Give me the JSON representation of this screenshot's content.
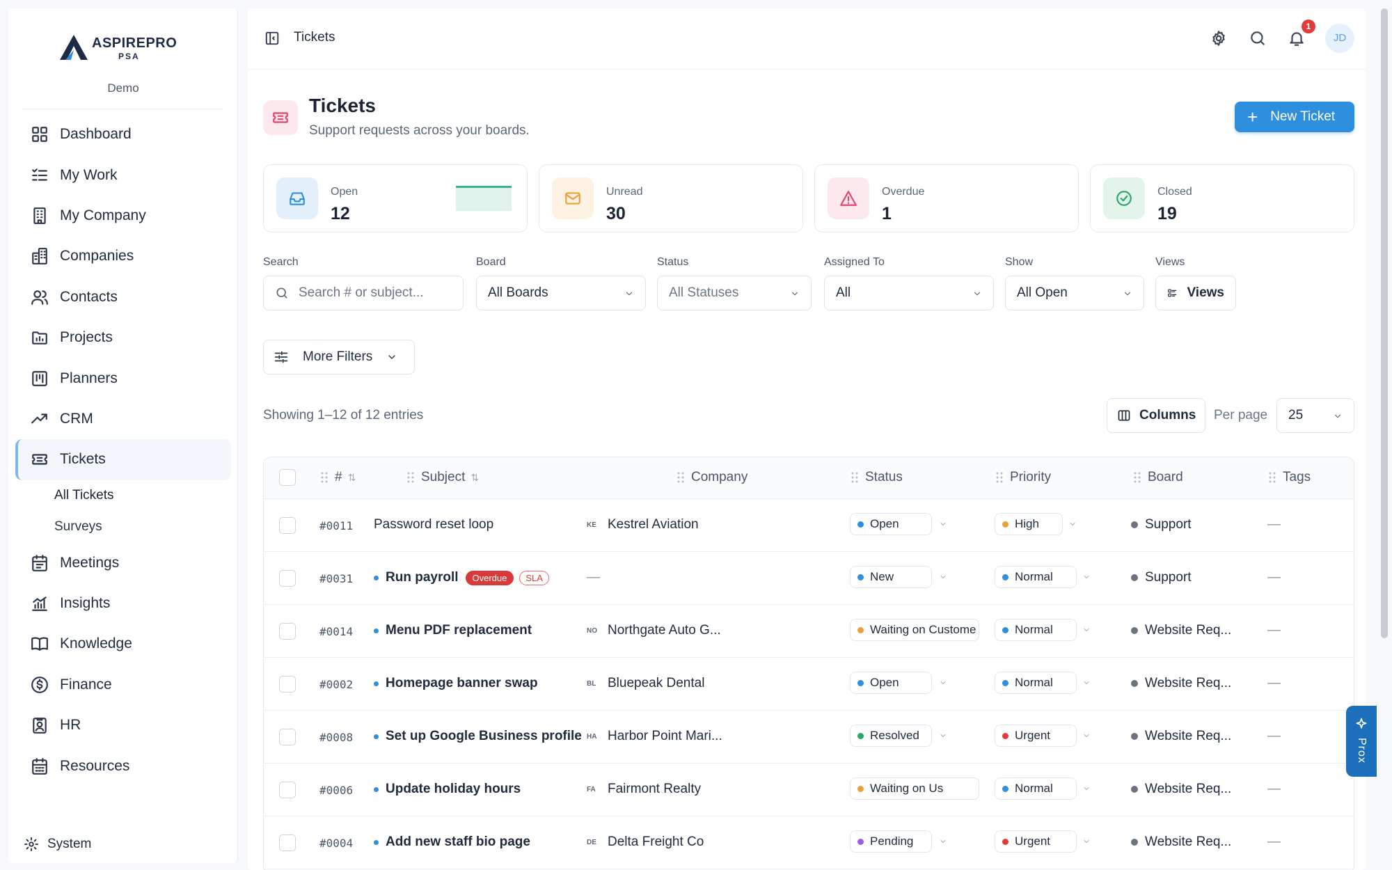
{
  "brand": {
    "name": "ASPIREPRO",
    "sub": "PSA",
    "workspace": "Demo"
  },
  "sidebar": {
    "items": [
      {
        "label": "Dashboard",
        "icon": "dashboard-icon"
      },
      {
        "label": "My Work",
        "icon": "checklist-icon"
      },
      {
        "label": "My Company",
        "icon": "building-icon"
      },
      {
        "label": "Companies",
        "icon": "buildings-icon"
      },
      {
        "label": "Contacts",
        "icon": "users-icon"
      },
      {
        "label": "Projects",
        "icon": "folder-chart-icon"
      },
      {
        "label": "Planners",
        "icon": "kanban-icon"
      },
      {
        "label": "CRM",
        "icon": "trending-up-icon"
      },
      {
        "label": "Tickets",
        "icon": "ticket-icon"
      }
    ],
    "subitems": [
      {
        "label": "All Tickets"
      },
      {
        "label": "Surveys"
      }
    ],
    "items_after": [
      {
        "label": "Meetings",
        "icon": "calendar-icon"
      },
      {
        "label": "Insights",
        "icon": "bar-chart-icon"
      },
      {
        "label": "Knowledge",
        "icon": "book-icon"
      },
      {
        "label": "Finance",
        "icon": "dollar-icon"
      },
      {
        "label": "HR",
        "icon": "badge-icon"
      },
      {
        "label": "Resources",
        "icon": "calendar-grid-icon"
      }
    ],
    "system": "System"
  },
  "topbar": {
    "breadcrumb": "Tickets",
    "notification_count": "1",
    "avatar": "JD"
  },
  "header": {
    "title": "Tickets",
    "subtitle": "Support requests across your boards.",
    "new_button": "New Ticket"
  },
  "stats": [
    {
      "label": "Open",
      "value": "12",
      "color": "#2f8fdf"
    },
    {
      "label": "Unread",
      "value": "30",
      "color": "#e9a23b"
    },
    {
      "label": "Overdue",
      "value": "1",
      "color": "#e2466b"
    },
    {
      "label": "Closed",
      "value": "19",
      "color": "#2ea56a"
    }
  ],
  "filters": {
    "search": {
      "label": "Search",
      "placeholder": "Search # or subject..."
    },
    "board": {
      "label": "Board",
      "value": "All Boards"
    },
    "status": {
      "label": "Status",
      "value": "All Statuses"
    },
    "assigned": {
      "label": "Assigned To",
      "value": "All"
    },
    "show": {
      "label": "Show",
      "value": "All Open"
    },
    "views": {
      "label": "Views",
      "button": "Views"
    },
    "more": "More Filters"
  },
  "list": {
    "showing": "Showing 1–12 of 12 entries",
    "columns_button": "Columns",
    "per_page_label": "Per page",
    "per_page": "25"
  },
  "table": {
    "headers": {
      "id": "#",
      "subject": "Subject",
      "company": "Company",
      "status": "Status",
      "priority": "Priority",
      "board": "Board",
      "tags": "Tags"
    },
    "rows": [
      {
        "id": "#0011",
        "subject": "Password reset loop",
        "unread": false,
        "badges": [],
        "company_abbr": "KE",
        "company": "Kestrel Aviation",
        "status": "Open",
        "status_color": "#2f8fdf",
        "priority": "High",
        "priority_color": "#e9a23b",
        "board": "Support",
        "tags": "—"
      },
      {
        "id": "#0031",
        "subject": "Run payroll",
        "unread": true,
        "badges": [
          "Overdue",
          "SLA"
        ],
        "company_abbr": "",
        "company": "—",
        "status": "New",
        "status_color": "#2f8fdf",
        "priority": "Normal",
        "priority_color": "#2f8fdf",
        "board": "Support",
        "tags": "—"
      },
      {
        "id": "#0014",
        "subject": "Menu PDF replacement",
        "unread": true,
        "badges": [],
        "company_abbr": "NO",
        "company": "Northgate Auto G...",
        "status": "Waiting on Custome",
        "status_color": "#e9a23b",
        "priority": "Normal",
        "priority_color": "#2f8fdf",
        "board": "Website Req...",
        "tags": "—"
      },
      {
        "id": "#0002",
        "subject": "Homepage banner swap",
        "unread": true,
        "badges": [],
        "company_abbr": "BL",
        "company": "Bluepeak Dental",
        "status": "Open",
        "status_color": "#2f8fdf",
        "priority": "Normal",
        "priority_color": "#2f8fdf",
        "board": "Website Req...",
        "tags": "—"
      },
      {
        "id": "#0008",
        "subject": "Set up Google Business profile",
        "unread": true,
        "badges": [],
        "company_abbr": "HA",
        "company": "Harbor Point Mari...",
        "status": "Resolved",
        "status_color": "#2ea56a",
        "priority": "Urgent",
        "priority_color": "#e03b3b",
        "board": "Website Req...",
        "tags": "—"
      },
      {
        "id": "#0006",
        "subject": "Update holiday hours",
        "unread": true,
        "badges": [],
        "company_abbr": "FA",
        "company": "Fairmont Realty",
        "status": "Waiting on Us",
        "status_color": "#e9a23b",
        "priority": "Normal",
        "priority_color": "#2f8fdf",
        "board": "Website Req...",
        "tags": "—"
      },
      {
        "id": "#0004",
        "subject": "Add new staff bio page",
        "unread": true,
        "badges": [],
        "company_abbr": "DE",
        "company": "Delta Freight Co",
        "status": "Pending",
        "status_color": "#a05ce0",
        "priority": "Urgent",
        "priority_color": "#e03b3b",
        "board": "Website Req...",
        "tags": "—"
      }
    ]
  },
  "assistant": {
    "label": "Prox"
  }
}
